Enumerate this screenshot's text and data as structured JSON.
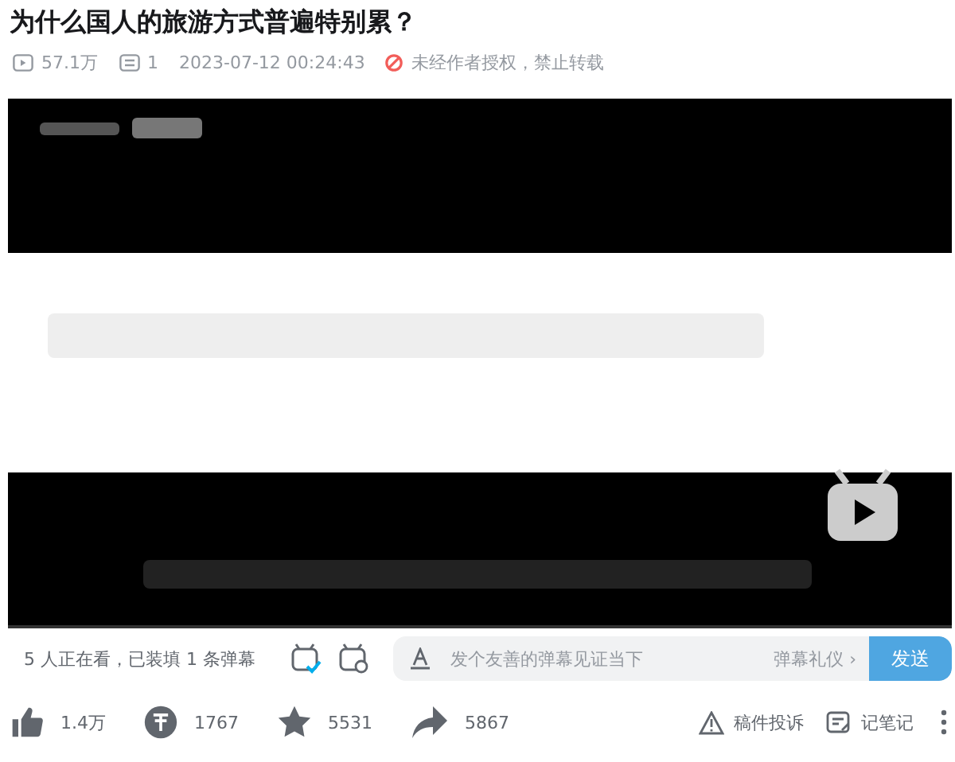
{
  "title": "为什么国人的旅游方式普遍特别累？",
  "meta": {
    "views": "57.1万",
    "danmaku": "1",
    "date": "2023-07-12 00:24:43",
    "copyright": "未经作者授权，禁止转载"
  },
  "danmaku_bar": {
    "status": "5 人正在看，已装填 1 条弹幕",
    "placeholder": "发个友善的弹幕见证当下",
    "etiquette": "弹幕礼仪",
    "etiquette_arrow": "›",
    "send": "发送",
    "danmaku_on": true
  },
  "actions": [
    {
      "kind": "like",
      "count": "1.4万"
    },
    {
      "kind": "coin",
      "count": "1767"
    },
    {
      "kind": "favorite",
      "count": "5531"
    },
    {
      "kind": "share",
      "count": "5867"
    }
  ],
  "tools": [
    {
      "kind": "report",
      "label": "稿件投诉"
    },
    {
      "kind": "note",
      "label": "记笔记"
    }
  ]
}
